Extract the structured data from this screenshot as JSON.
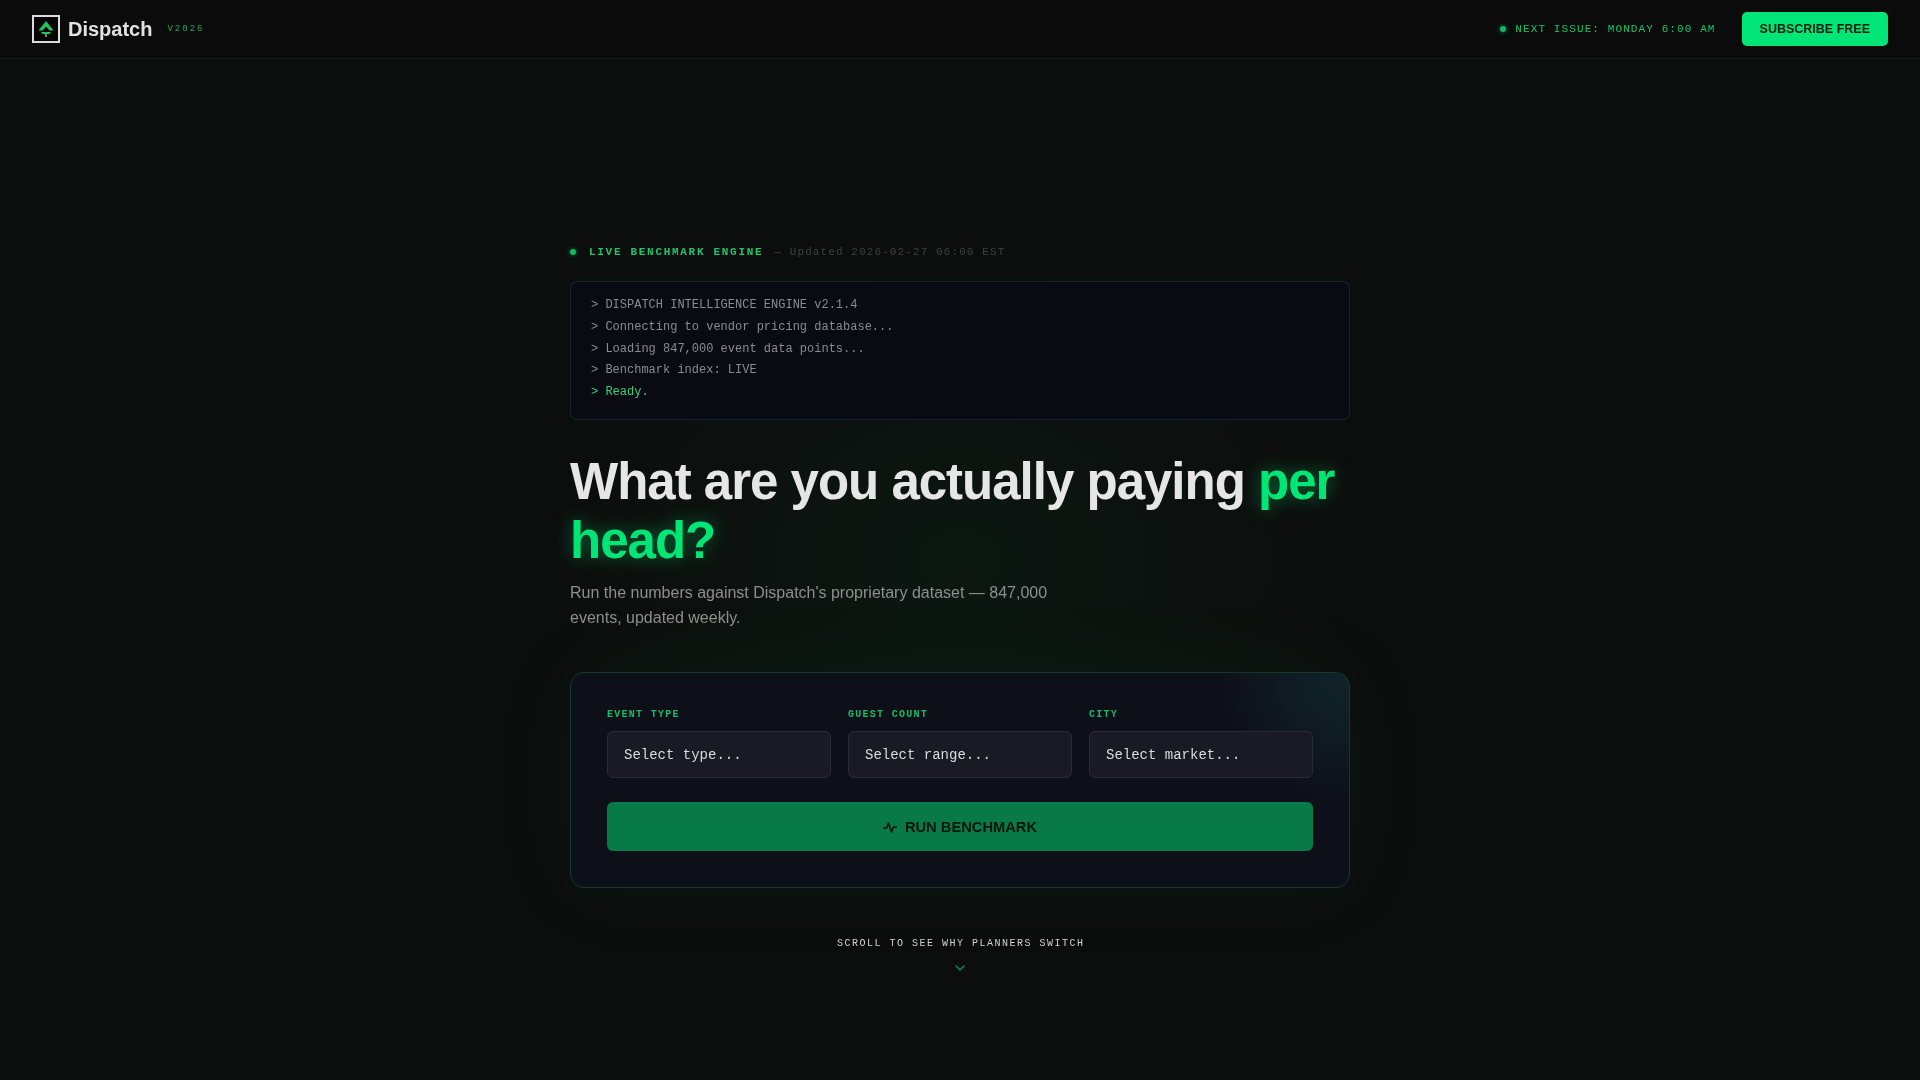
{
  "header": {
    "brand": "Dispatch",
    "version": "V2026",
    "next_issue": "NEXT ISSUE: MONDAY 6:00 AM",
    "subscribe_button": "SUBSCRIBE FREE"
  },
  "status": {
    "label": "LIVE BENCHMARK ENGINE",
    "updated": "— Updated 2026-02-27 06:00 EST"
  },
  "terminal": {
    "lines": [
      {
        "kind": "log",
        "text": "> DISPATCH INTELLIGENCE ENGINE v2.1.4"
      },
      {
        "kind": "log",
        "text": "> Connecting to vendor pricing database..."
      },
      {
        "kind": "log",
        "text": "> Loading 847,000 event data points..."
      },
      {
        "kind": "log",
        "text": "> Benchmark index: LIVE"
      },
      {
        "kind": "success",
        "text": "> Ready."
      }
    ]
  },
  "hero": {
    "headline": "What are you actually paying",
    "headline_highlight": "per head?",
    "subtitle": "Run the numbers against Dispatch's proprietary dataset — 847,000 events, updated weekly."
  },
  "benchmark_form": {
    "fields": [
      {
        "label": "EVENT TYPE",
        "placeholder": "Select type..."
      },
      {
        "label": "GUEST COUNT",
        "placeholder": "Select range..."
      },
      {
        "label": "CITY",
        "placeholder": "Select market..."
      }
    ],
    "run_button": "RUN BENCHMARK"
  },
  "scroll_hint": "SCROLL TO SEE WHY PLANNERS SWITCH"
}
